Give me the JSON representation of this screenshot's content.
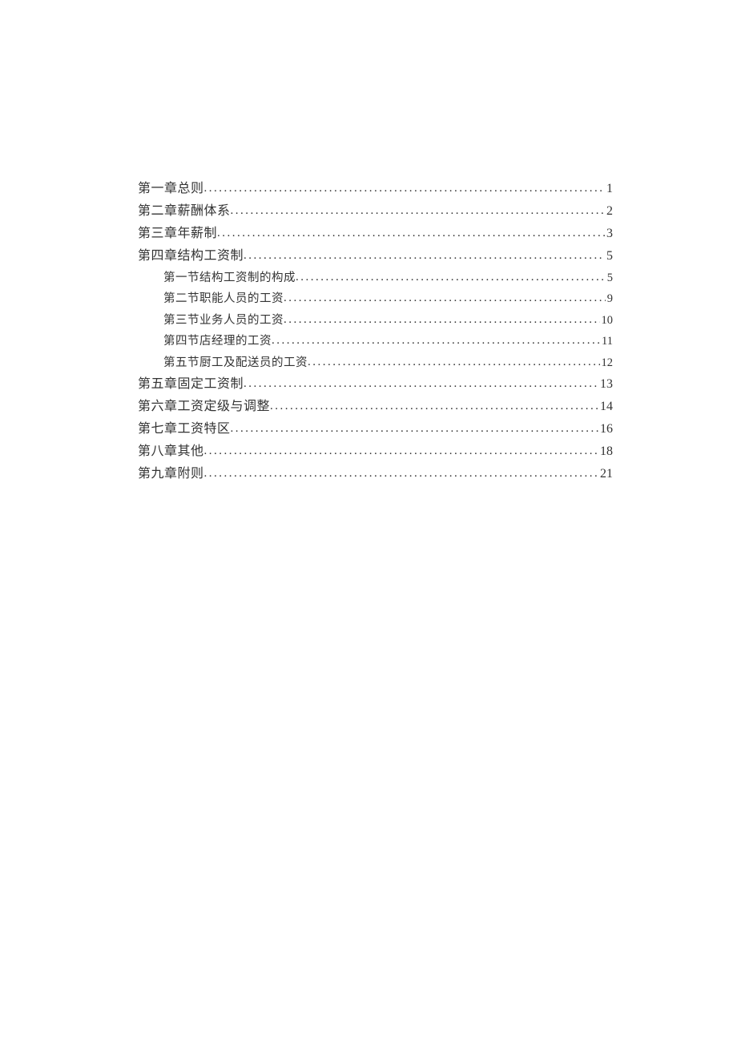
{
  "toc": [
    {
      "title": "第一章总则",
      "page": "1",
      "indent": false
    },
    {
      "title": "第二章薪酬体系",
      "page": "2",
      "indent": false
    },
    {
      "title": "第三章年薪制",
      "page": "3",
      "indent": false
    },
    {
      "title": "第四章结构工资制",
      "page": "5",
      "indent": false
    },
    {
      "title": "第一节结构工资制的构成",
      "page": "5",
      "indent": true
    },
    {
      "title": "第二节职能人员的工资",
      "page": "9",
      "indent": true
    },
    {
      "title": "第三节业务人员的工资",
      "page": "10",
      "indent": true
    },
    {
      "title": "第四节店经理的工资",
      "page": "11",
      "indent": true
    },
    {
      "title": "第五节厨工及配送员的工资",
      "page": "12",
      "indent": true
    },
    {
      "title": "第五章固定工资制 ",
      "page": "13",
      "indent": false
    },
    {
      "title": "第六章工资定级与调整 ",
      "page": "14",
      "indent": false
    },
    {
      "title": "第七章工资特区 ",
      "page": "16",
      "indent": false
    },
    {
      "title": "第八章其他 ",
      "page": "18",
      "indent": false
    },
    {
      "title": "第九章附则 ",
      "page": "21",
      "indent": false
    }
  ]
}
